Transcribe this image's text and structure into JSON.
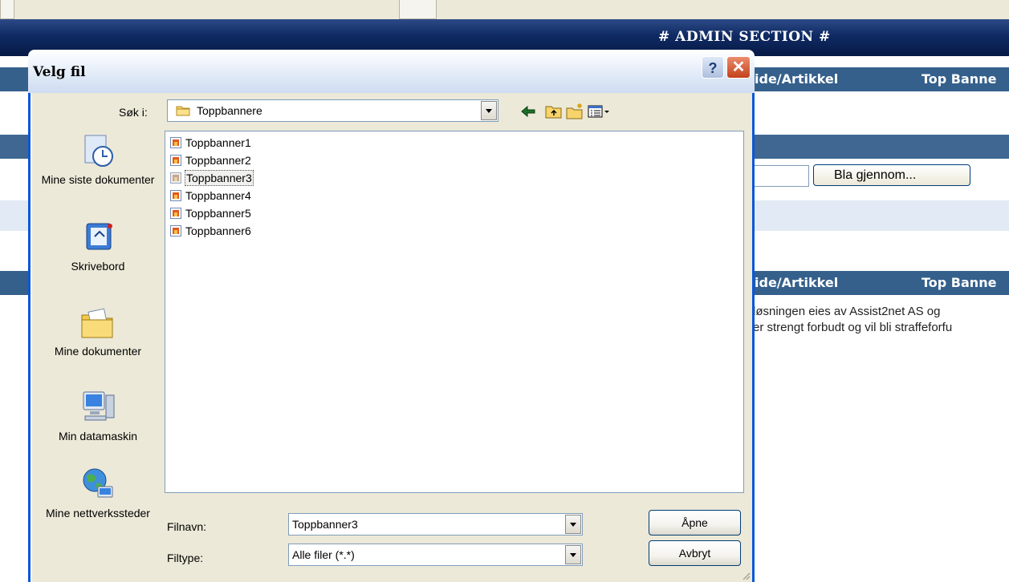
{
  "page": {
    "admin_title": "# ADMIN SECTION #",
    "nav_items": [
      "ide/Artikkel",
      "Top Banne"
    ],
    "browse_button": "Bla gjennom...",
    "footer_lines": [
      "løsningen eies av Assist2net AS og",
      "er strengt forbudt og vil bli straffeforfu"
    ]
  },
  "dialog": {
    "title": "Velg fil",
    "help_label": "?",
    "close_label": "✕",
    "look_in_label": "Søk i:",
    "look_in_value": "Toppbannere",
    "places": [
      {
        "label": "Mine siste dokumenter",
        "icon": "recent-documents-icon"
      },
      {
        "label": "Skrivebord",
        "icon": "desktop-icon"
      },
      {
        "label": "Mine dokumenter",
        "icon": "my-documents-icon"
      },
      {
        "label": "Min datamaskin",
        "icon": "my-computer-icon"
      },
      {
        "label": "Mine nettverkssteder",
        "icon": "network-places-icon"
      }
    ],
    "files": [
      "Toppbanner1",
      "Toppbanner2",
      "Toppbanner3",
      "Toppbanner4",
      "Toppbanner5",
      "Toppbanner6"
    ],
    "selected_file": "Toppbanner3",
    "filename_label": "Filnavn:",
    "filename_value": "Toppbanner3",
    "filetype_label": "Filtype:",
    "filetype_value": "Alle filer (*.*)",
    "open_button": "Åpne",
    "cancel_button": "Avbryt"
  },
  "colors": {
    "title_bar_dark": "#071a45",
    "nav_bar": "#35608c",
    "dialog_body": "#ece9d8",
    "dialog_frame": "#0b57d8",
    "close_red": "#c3411c"
  }
}
